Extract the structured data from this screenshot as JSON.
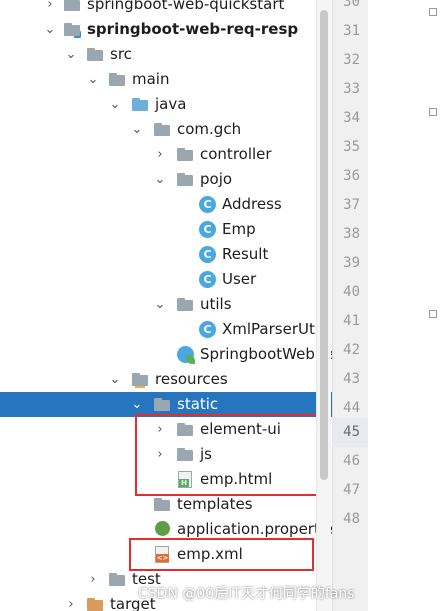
{
  "tree": {
    "rows": [
      {
        "label": "springboot-web-quickstart",
        "chev": ">",
        "icon": "module-folder-icon",
        "bold": false
      },
      {
        "label": "springboot-web-req-resp",
        "chev": "v",
        "icon": "module-folder-icon",
        "bold": true
      },
      {
        "label": "src",
        "chev": "v",
        "icon": "folder-icon"
      },
      {
        "label": "main",
        "chev": "v",
        "icon": "folder-icon"
      },
      {
        "label": "java",
        "chev": "v",
        "icon": "source-folder-icon"
      },
      {
        "label": "com.gch",
        "chev": "v",
        "icon": "package-icon"
      },
      {
        "label": "controller",
        "chev": ">",
        "icon": "package-icon"
      },
      {
        "label": "pojo",
        "chev": "v",
        "icon": "package-icon"
      },
      {
        "label": "Address",
        "chev": "",
        "icon": "class-icon"
      },
      {
        "label": "Emp",
        "chev": "",
        "icon": "class-icon"
      },
      {
        "label": "Result",
        "chev": "",
        "icon": "class-icon"
      },
      {
        "label": "User",
        "chev": "",
        "icon": "class-icon"
      },
      {
        "label": "utils",
        "chev": "v",
        "icon": "package-icon"
      },
      {
        "label": "XmlParserUtils",
        "chev": "",
        "icon": "class-icon"
      },
      {
        "label": "SpringbootWebReqRespApplication",
        "chev": "",
        "icon": "spring-class-icon"
      },
      {
        "label": "resources",
        "chev": "v",
        "icon": "resources-folder-icon"
      },
      {
        "label": "static",
        "chev": "v",
        "icon": "folder-icon",
        "selected": true
      },
      {
        "label": "element-ui",
        "chev": ">",
        "icon": "folder-icon"
      },
      {
        "label": "js",
        "chev": ">",
        "icon": "folder-icon"
      },
      {
        "label": "emp.html",
        "chev": "",
        "icon": "html-file-icon"
      },
      {
        "label": "templates",
        "chev": "",
        "icon": "folder-icon"
      },
      {
        "label": "application.properties",
        "chev": "",
        "icon": "properties-file-icon"
      },
      {
        "label": "emp.xml",
        "chev": "",
        "icon": "xml-file-icon"
      },
      {
        "label": "test",
        "chev": ">",
        "icon": "folder-icon"
      },
      {
        "label": "target",
        "chev": ">",
        "icon": "excluded-folder-icon"
      }
    ],
    "class_badge": "C",
    "html_badge": "H",
    "xml_badge": "<>"
  },
  "gutter": {
    "line_numbers": [
      "30",
      "31",
      "32",
      "33",
      "34",
      "35",
      "36",
      "37",
      "38",
      "39",
      "40",
      "41",
      "42",
      "43",
      "44",
      "45",
      "46",
      "47",
      "48"
    ],
    "current_line": "45"
  },
  "watermark": "CSDN @00后IT天才何同学的fans",
  "colors": {
    "selection": "#2675bf",
    "highlight_box": "#e0302e",
    "class_icon": "#4aa8e0"
  }
}
